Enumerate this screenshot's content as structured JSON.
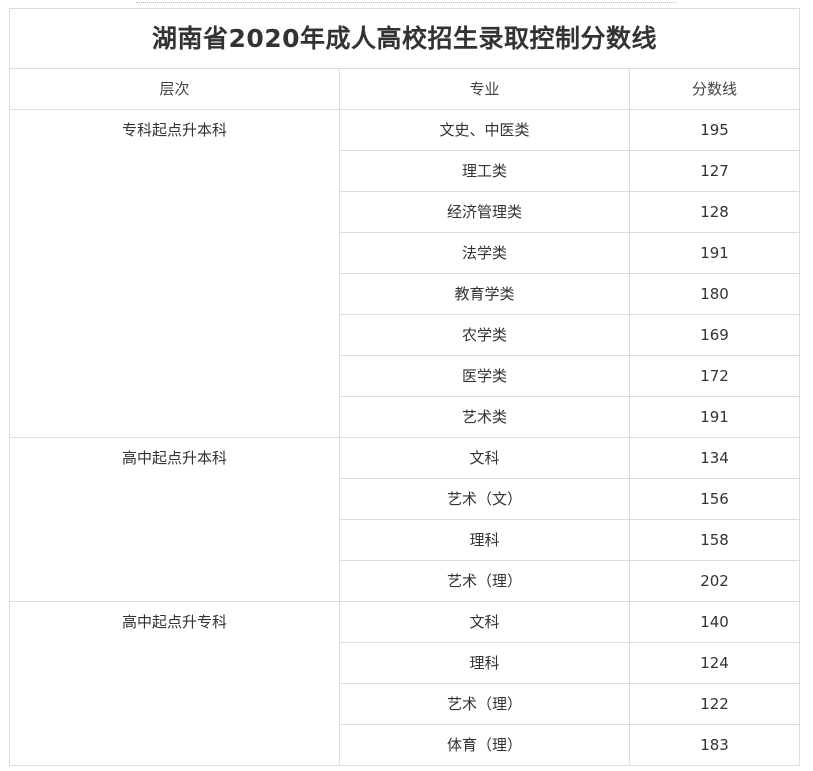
{
  "table": {
    "title": "湖南省2020年成人高校招生录取控制分数线",
    "headers": [
      "层次",
      "专业",
      "分数线"
    ],
    "groups": [
      {
        "level": "专科起点升本科",
        "rows": [
          {
            "major": "文史、中医类",
            "score": "195"
          },
          {
            "major": "理工类",
            "score": "127"
          },
          {
            "major": "经济管理类",
            "score": "128"
          },
          {
            "major": "法学类",
            "score": "191"
          },
          {
            "major": "教育学类",
            "score": "180"
          },
          {
            "major": "农学类",
            "score": "169"
          },
          {
            "major": "医学类",
            "score": "172"
          },
          {
            "major": "艺术类",
            "score": "191"
          }
        ]
      },
      {
        "level": "高中起点升本科",
        "rows": [
          {
            "major": "文科",
            "score": "134"
          },
          {
            "major": "艺术（文）",
            "score": "156"
          },
          {
            "major": "理科",
            "score": "158"
          },
          {
            "major": "艺术（理）",
            "score": "202"
          }
        ]
      },
      {
        "level": "高中起点升专科",
        "rows": [
          {
            "major": "文科",
            "score": "140"
          },
          {
            "major": "理科",
            "score": "124"
          },
          {
            "major": "艺术（理）",
            "score": "122"
          },
          {
            "major": "体育（理）",
            "score": "183"
          }
        ]
      }
    ]
  }
}
